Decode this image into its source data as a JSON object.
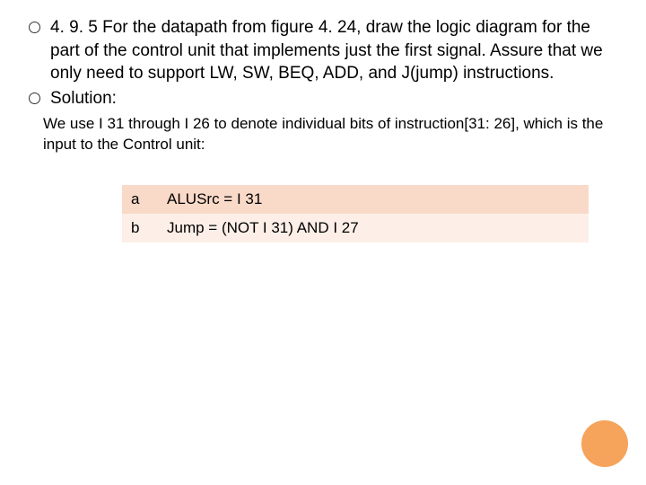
{
  "bullets": {
    "item1": "4. 9. 5  For the datapath from figure 4. 24, draw the logic diagram for the part of the control unit that implements just the first signal. Assure that we only need to support LW, SW, BEQ, ADD, and J(jump) instructions.",
    "item2": "Solution:"
  },
  "subtext": "We use I 31 through I 26 to denote individual bits of instruction[31: 26], which is the input to the Control unit:",
  "table": {
    "a_label": "a",
    "a_value": "ALUSrc = I 31",
    "b_label": "b",
    "b_value": "Jump = (NOT I 31) AND I 27"
  }
}
